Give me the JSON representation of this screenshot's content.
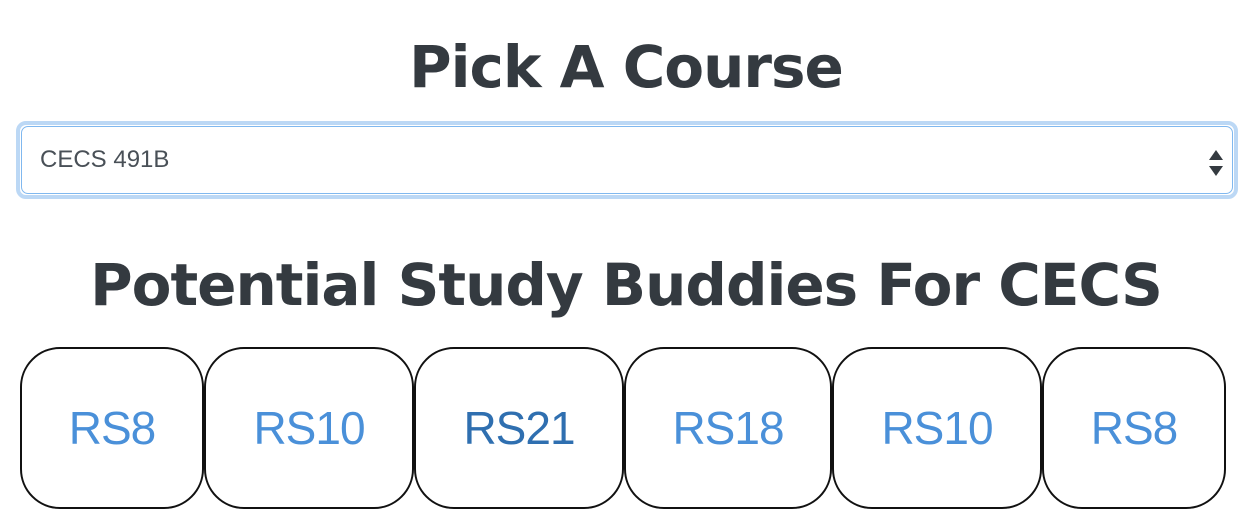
{
  "page": {
    "title": "Pick A Course",
    "section_title": "Potential Study Buddies For CECS"
  },
  "course_select": {
    "selected": "CECS 491B"
  },
  "buddies": [
    {
      "label": "RS8"
    },
    {
      "label": "RS10"
    },
    {
      "label": "RS21"
    },
    {
      "label": "RS18"
    },
    {
      "label": "RS10"
    },
    {
      "label": "RS8"
    }
  ],
  "colors": {
    "heading": "#343a40",
    "link": "#4a90d9",
    "focus_ring": "#bcd8f5",
    "card_border": "#111111"
  },
  "icons": {
    "select_arrow": "chevron-up-down-icon"
  }
}
